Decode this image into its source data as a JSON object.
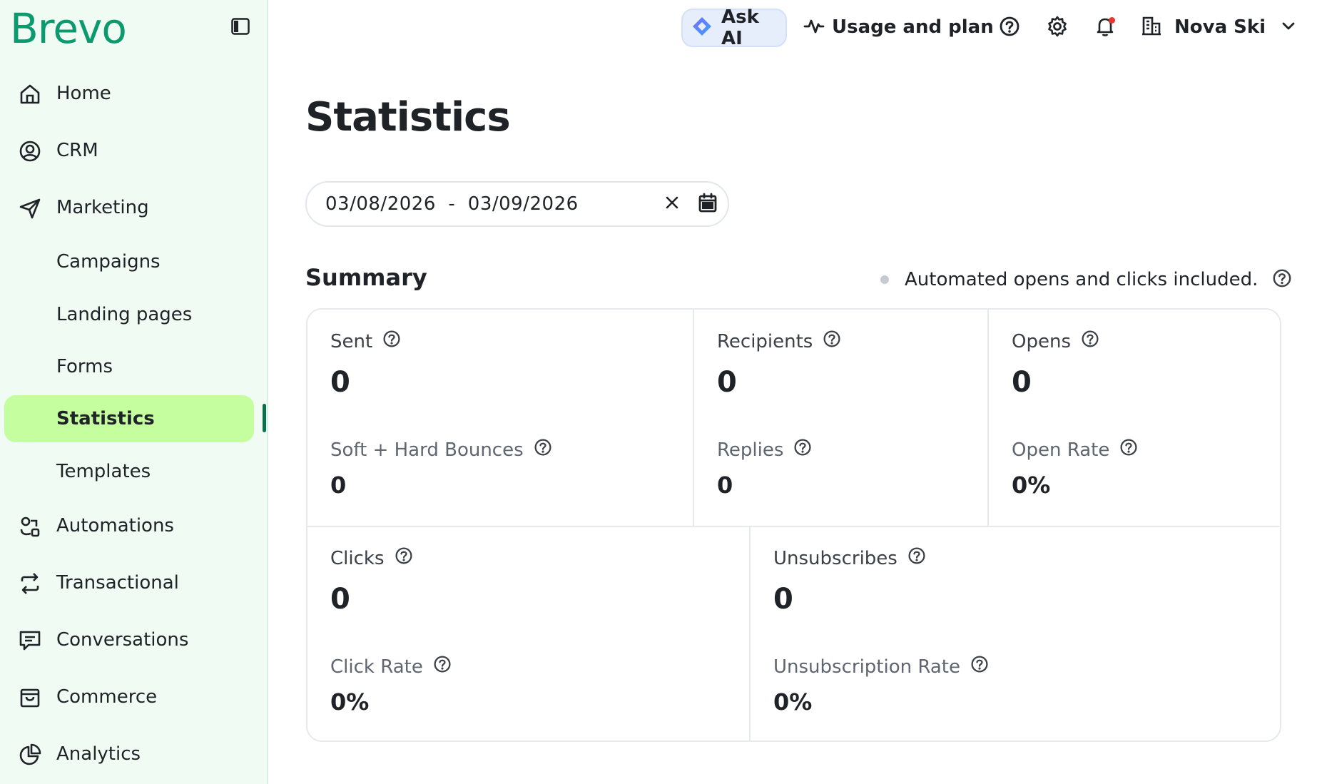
{
  "brand": {
    "logo_text": "Brevo",
    "color": "#0b996e"
  },
  "sidebar": {
    "collapse_icon": "sidebar-collapse-icon",
    "items": [
      {
        "label": "Home",
        "icon": "home-icon"
      },
      {
        "label": "CRM",
        "icon": "user-circle-icon"
      },
      {
        "label": "Marketing",
        "icon": "send-icon"
      },
      {
        "label": "Campaigns"
      },
      {
        "label": "Landing pages"
      },
      {
        "label": "Forms"
      },
      {
        "label": "Statistics",
        "active": true
      },
      {
        "label": "Templates"
      },
      {
        "label": "Automations",
        "icon": "automation-icon"
      },
      {
        "label": "Transactional",
        "icon": "transfer-icon"
      },
      {
        "label": "Conversations",
        "icon": "chat-icon"
      },
      {
        "label": "Commerce",
        "icon": "shopping-bag-icon"
      },
      {
        "label": "Analytics",
        "icon": "pie-chart-icon"
      }
    ]
  },
  "topbar": {
    "ask_ai_label": "Ask AI",
    "usage_label": "Usage and plan",
    "account_name": "Nova Ski",
    "notification_dot_color": "#e5372f"
  },
  "page": {
    "title": "Statistics",
    "date_range": "03/08/2026  -  03/09/2026"
  },
  "summary": {
    "title": "Summary",
    "note": "Automated opens and clicks included.",
    "metrics": {
      "sent": {
        "label": "Sent",
        "value": "0"
      },
      "recipients": {
        "label": "Recipients",
        "value": "0"
      },
      "opens": {
        "label": "Opens",
        "value": "0"
      },
      "bounces": {
        "label": "Soft + Hard Bounces",
        "value": "0"
      },
      "replies": {
        "label": "Replies",
        "value": "0"
      },
      "open_rate": {
        "label": "Open Rate",
        "value": "0%"
      },
      "clicks": {
        "label": "Clicks",
        "value": "0"
      },
      "unsubscribes": {
        "label": "Unsubscribes",
        "value": "0"
      },
      "click_rate": {
        "label": "Click Rate",
        "value": "0%"
      },
      "unsub_rate": {
        "label": "Unsubscription Rate",
        "value": "0%"
      }
    }
  },
  "colors": {
    "sidebar_bg": "#effbf3",
    "active_bg": "#c4fe9e",
    "ask_ai_bg": "#e6eefc"
  }
}
